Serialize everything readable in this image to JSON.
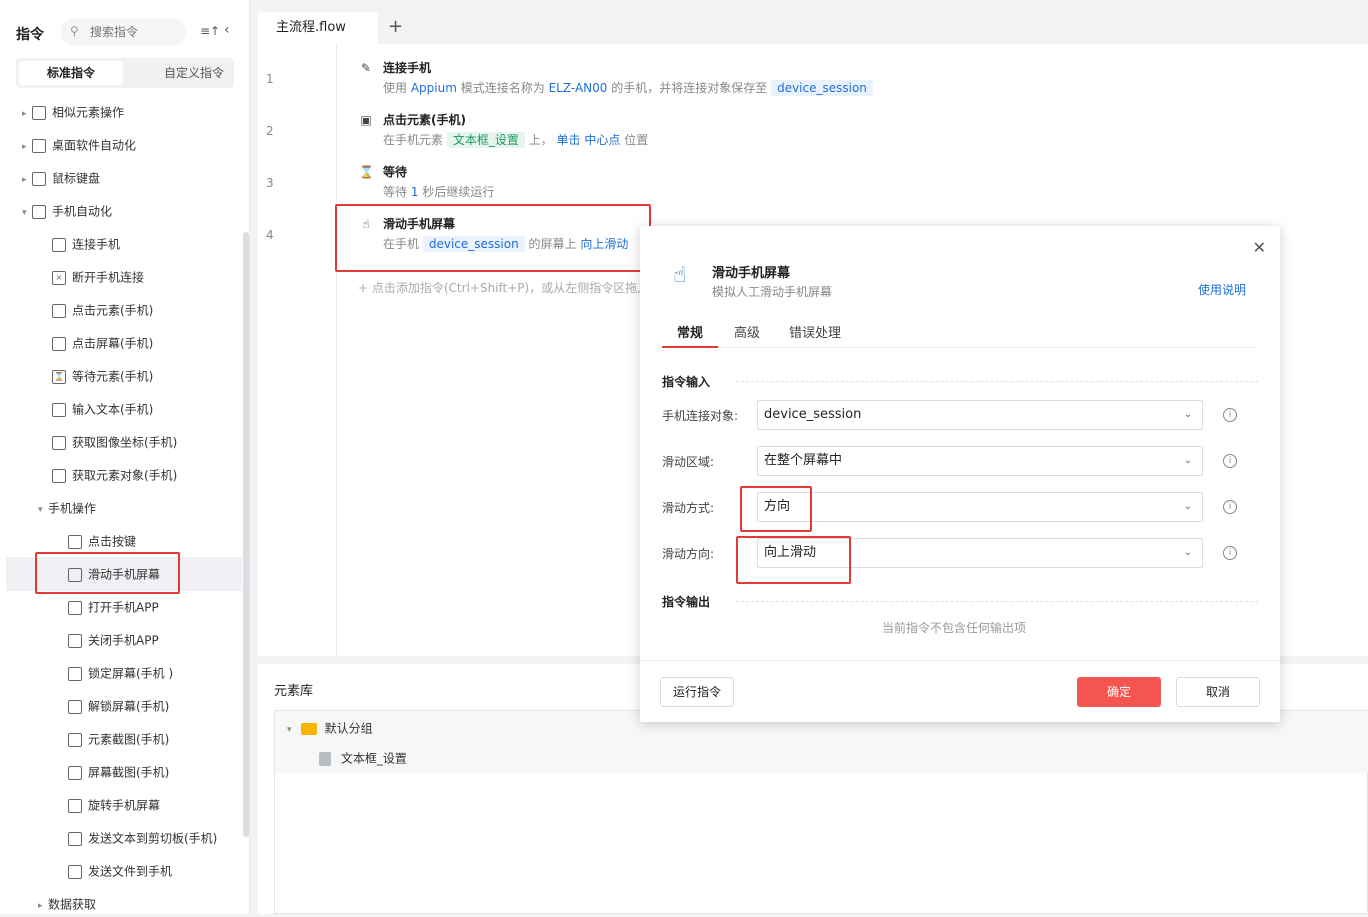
{
  "sidebar": {
    "title": "指令",
    "search_placeholder": "搜索指令",
    "sort_icon": "sort-icon",
    "tabs": [
      "标准指令",
      "自定义指令"
    ],
    "tree": [
      {
        "label": "相似元素操作",
        "icon": "copy-icon"
      },
      {
        "label": "桌面软件自动化",
        "icon": "monitor-icon"
      },
      {
        "label": "鼠标键盘",
        "icon": "cursor-icon"
      },
      {
        "label": "手机自动化",
        "icon": "phone-icon"
      },
      {
        "label": "连接手机",
        "icon": "connect-icon"
      },
      {
        "label": "断开手机连接",
        "icon": "disconnect-icon"
      },
      {
        "label": "点击元素(手机)",
        "icon": "tap-element-icon"
      },
      {
        "label": "点击屏幕(手机)",
        "icon": "tap-screen-icon"
      },
      {
        "label": "等待元素(手机)",
        "icon": "hourglass-icon"
      },
      {
        "label": "输入文本(手机)",
        "icon": "text-input-icon"
      },
      {
        "label": "获取图像坐标(手机)",
        "icon": "image-coord-icon"
      },
      {
        "label": "获取元素对象(手机)",
        "icon": "element-object-icon"
      },
      {
        "label": "手机操作",
        "icon": ""
      },
      {
        "label": "点击按键",
        "icon": "key-icon"
      },
      {
        "label": "滑动手机屏幕",
        "icon": "swipe-icon"
      },
      {
        "label": "打开手机APP",
        "icon": "open-app-icon"
      },
      {
        "label": "关闭手机APP",
        "icon": "close-app-icon"
      },
      {
        "label": "锁定屏幕(手机 )",
        "icon": "lock-icon"
      },
      {
        "label": "解锁屏幕(手机)",
        "icon": "unlock-icon"
      },
      {
        "label": "元素截图(手机)",
        "icon": "element-screenshot-icon"
      },
      {
        "label": "屏幕截图(手机)",
        "icon": "screenshot-icon"
      },
      {
        "label": "旋转手机屏幕",
        "icon": "rotate-icon"
      },
      {
        "label": "发送文本到剪切板(手机)",
        "icon": "clipboard-icon"
      },
      {
        "label": "发送文件到手机",
        "icon": "send-file-icon"
      },
      {
        "label": "数据获取",
        "icon": ""
      }
    ]
  },
  "tabs": {
    "active": "主流程.flow",
    "add": "+"
  },
  "flow": {
    "lines": [
      "1",
      "2",
      "3",
      "4"
    ],
    "step1": {
      "title": "连接手机",
      "d1": "使用",
      "d2": "Appium",
      "d3": "模式连接名称为",
      "d4": "ELZ-AN00",
      "d5": "的手机，并将连接对象保存至",
      "d6": "device_session"
    },
    "step2": {
      "title": "点击元素(手机)",
      "d1": "在手机元素",
      "d2": "文本框_设置",
      "d3": "上，",
      "d4": "单击",
      "d5": "中心点",
      "d6": "位置"
    },
    "step3": {
      "title": "等待",
      "d1": "等待",
      "d2": "1",
      "d3": "秒后继续运行"
    },
    "step4": {
      "title": "滑动手机屏幕",
      "d1": "在手机",
      "d2": "device_session",
      "d3": "的屏幕上",
      "d4": "向上滑动"
    },
    "add_hint": "+ 点击添加指令(Ctrl+Shift+P)，或从左侧指令区拖入"
  },
  "element_library": {
    "title": "元素库",
    "group": "默认分组",
    "item": "文本框_设置"
  },
  "dialog": {
    "title": "滑动手机屏幕",
    "subtitle": "模拟人工滑动手机屏幕",
    "help": "使用说明",
    "tabs": [
      "常规",
      "高级",
      "错误处理"
    ],
    "input_section": "指令输入",
    "fields": [
      {
        "label": "手机连接对象:",
        "value": "device_session"
      },
      {
        "label": "滑动区域:",
        "value": "在整个屏幕中"
      },
      {
        "label": "滑动方式:",
        "value": "方向"
      },
      {
        "label": "滑动方向:",
        "value": "向上滑动"
      }
    ],
    "output_section": "指令输出",
    "no_output": "当前指令不包含任何输出项",
    "run_button": "运行指令",
    "ok_button": "确定",
    "cancel_button": "取消"
  },
  "colors": {
    "accent_red": "#e53935",
    "primary_button": "#f4554f",
    "link_blue": "#1e6fd9"
  }
}
